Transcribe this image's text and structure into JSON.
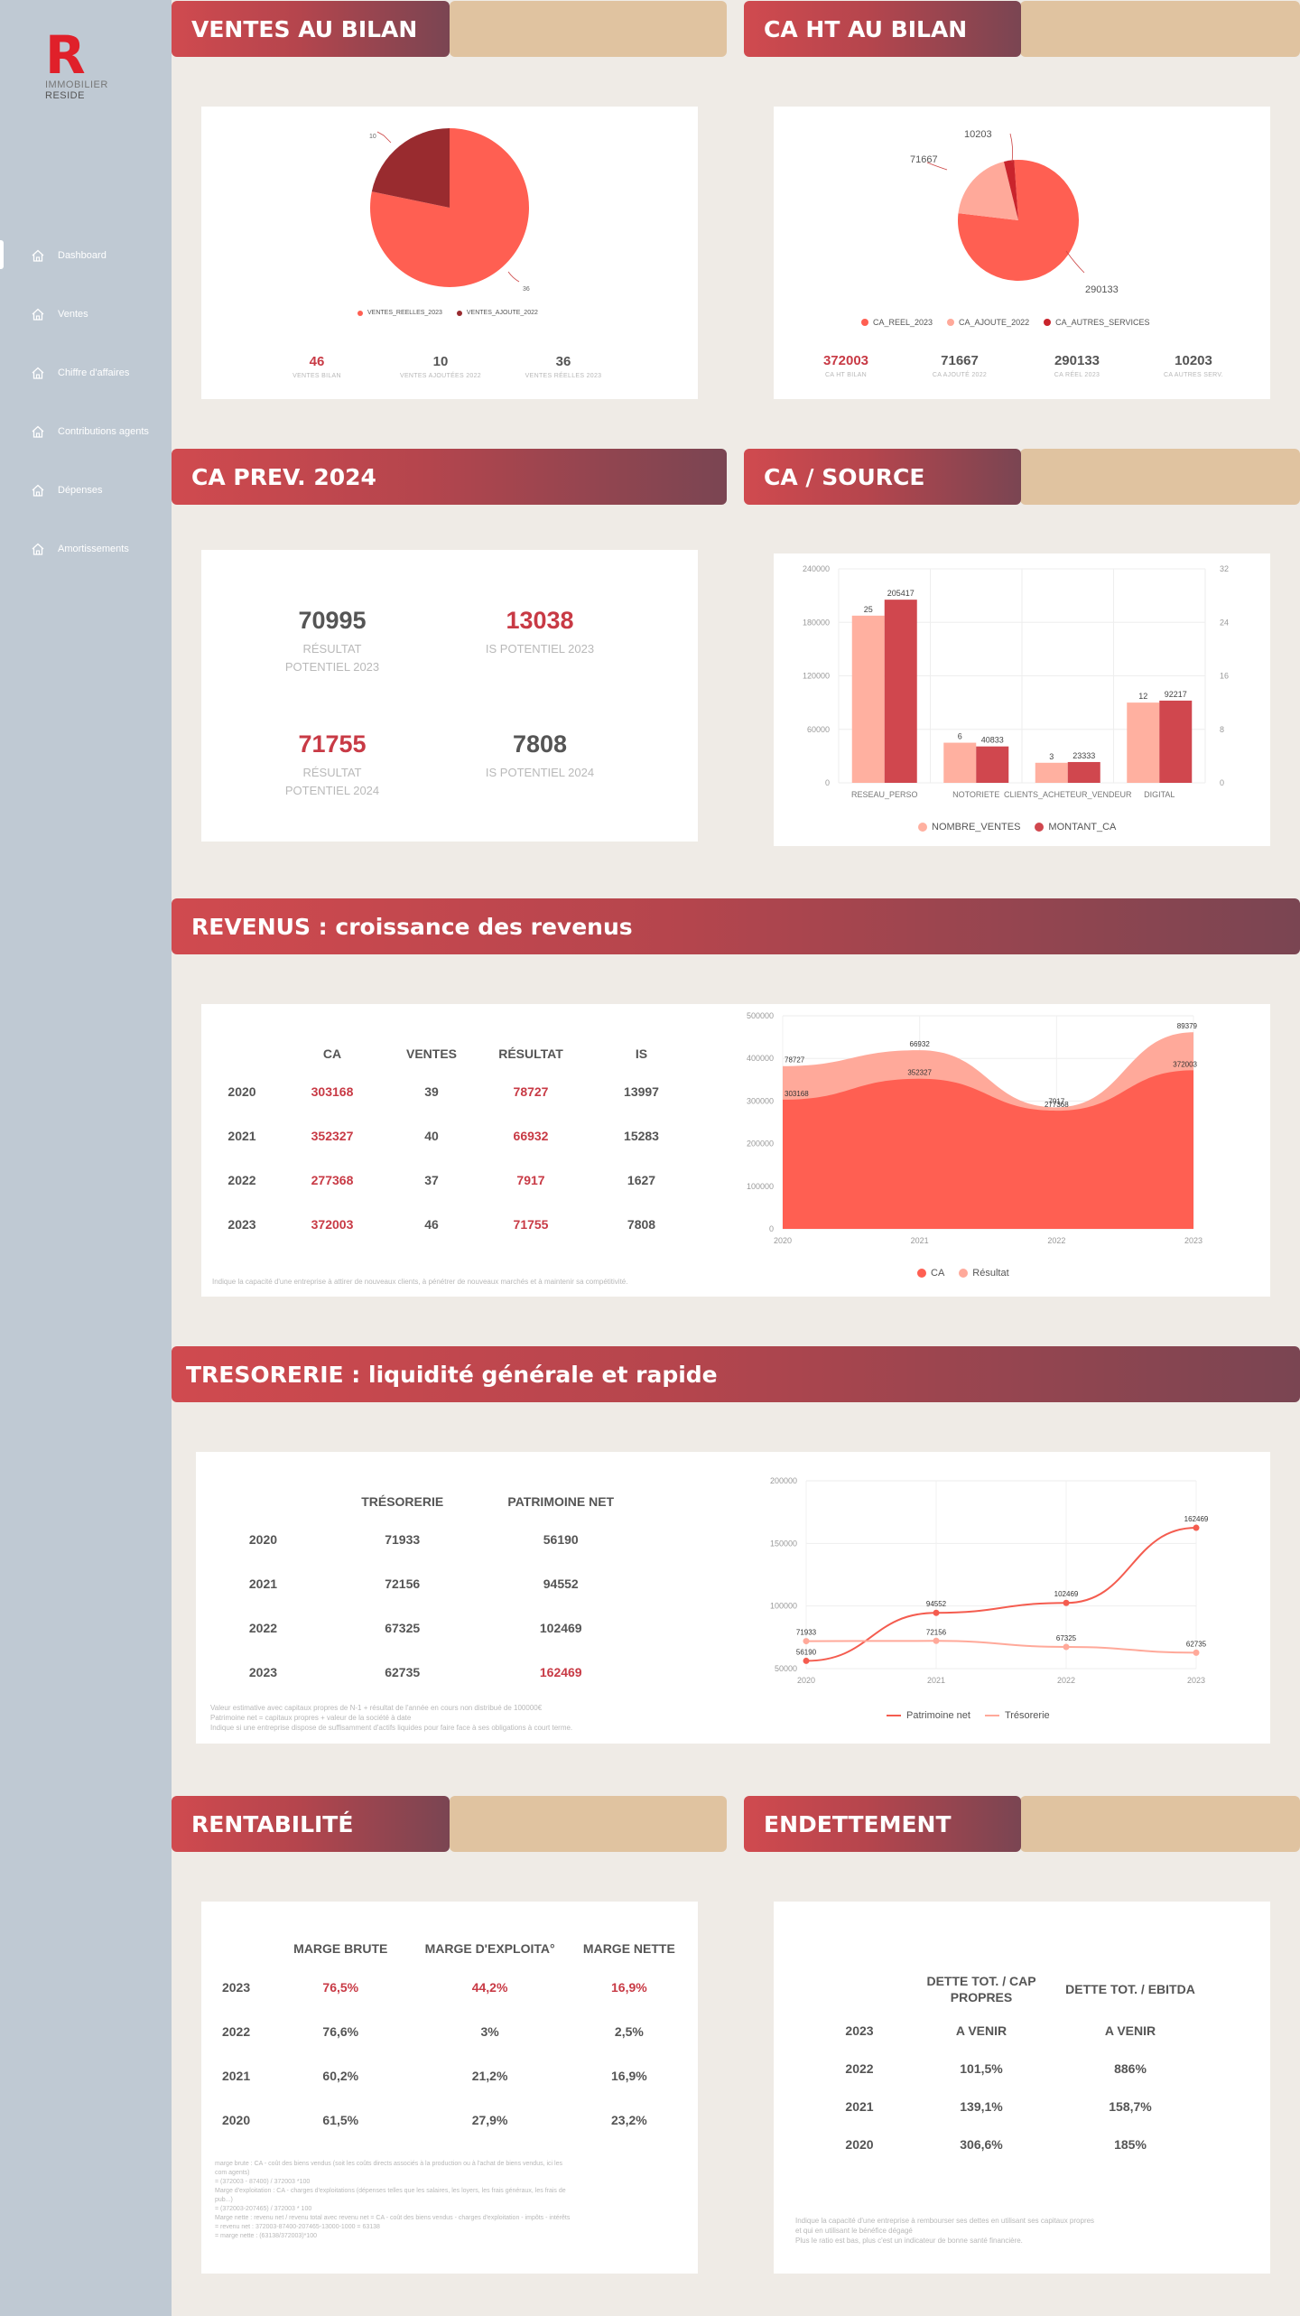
{
  "sidebar": {
    "logo_letter": "R",
    "logo_line1": "IMMOBILIER",
    "logo_line2": "RESIDE",
    "items": [
      {
        "label": "Dashboard"
      },
      {
        "label": "Ventes"
      },
      {
        "label": "Chiffre d'affaires"
      },
      {
        "label": "Contributions agents"
      },
      {
        "label": "Dépenses"
      },
      {
        "label": "Amortissements"
      }
    ]
  },
  "ventes": {
    "title": "VENTES AU BILAN",
    "legend": [
      "VENTES_REELLES_2023",
      "VENTES_AJOUTE_2022"
    ],
    "stats": [
      {
        "value": "46",
        "label": "VENTES BILAN"
      },
      {
        "value": "10",
        "label": "VENTES AJOUTÉES 2022"
      },
      {
        "value": "36",
        "label": "VENTES RÉELLES 2023"
      }
    ],
    "pie_labels": [
      "10",
      "36"
    ]
  },
  "ca_ht": {
    "title": "CA HT AU BILAN",
    "legend": [
      "CA_REEL_2023",
      "CA_AJOUTE_2022",
      "CA_AUTRES_SERVICES"
    ],
    "stats": [
      {
        "value": "372003",
        "label": "CA HT BILAN"
      },
      {
        "value": "71667",
        "label": "CA AJOUTÉ 2022"
      },
      {
        "value": "290133",
        "label": "CA RÉEL 2023"
      },
      {
        "value": "10203",
        "label": "CA AUTRES SERV."
      }
    ],
    "pie_labels": [
      "10203",
      "71667",
      "290133"
    ]
  },
  "ca_prev": {
    "title": "CA PREV. 2024",
    "items": [
      {
        "value": "70995",
        "label1": "RÉSULTAT",
        "label2": "POTENTIEL 2023"
      },
      {
        "value": "13038",
        "label1": "IS POTENTIEL 2023",
        "label2": ""
      },
      {
        "value": "71755",
        "label1": "RÉSULTAT",
        "label2": "POTENTIEL 2024"
      },
      {
        "value": "7808",
        "label1": "IS POTENTIEL 2024",
        "label2": ""
      }
    ]
  },
  "ca_source": {
    "title": "CA / SOURCE",
    "legend": [
      "NOMBRE_VENTES",
      "MONTANT_CA"
    ]
  },
  "revenus": {
    "title": "REVENUS : croissance des revenus",
    "headers": [
      "",
      "CA",
      "VENTES",
      "RÉSULTAT",
      "IS"
    ],
    "rows": [
      [
        "2020",
        "303168",
        "39",
        "78727",
        "13997"
      ],
      [
        "2021",
        "352327",
        "40",
        "66932",
        "15283"
      ],
      [
        "2022",
        "277368",
        "37",
        "7917",
        "1627"
      ],
      [
        "2023",
        "372003",
        "46",
        "71755",
        "7808"
      ]
    ],
    "note": "Indique la capacité d'une entreprise à attirer de nouveaux clients, à pénétrer de nouveaux marchés et à maintenir sa compétitivité.",
    "legend": [
      "CA",
      "Résultat"
    ]
  },
  "tresorerie": {
    "title": "TRESORERIE : liquidité générale et rapide",
    "headers": [
      "",
      "TRÉSORERIE",
      "PATRIMOINE NET"
    ],
    "rows": [
      [
        "2020",
        "71933",
        "56190"
      ],
      [
        "2021",
        "72156",
        "94552"
      ],
      [
        "2022",
        "67325",
        "102469"
      ],
      [
        "2023",
        "62735",
        "162469"
      ]
    ],
    "note_lines": [
      "Valeur estimative avec capitaux propres de N-1 + résultat de l'année en cours non distribué de 100000€",
      "Patrimoine net = capitaux propres + valeur de la société à date",
      "Indique si une entreprise dispose de suffisamment d'actifs liquides pour faire face à ses obligations à court terme."
    ],
    "legend": [
      "Patrimoine net",
      "Trésorerie"
    ]
  },
  "rentabilite": {
    "title": "RENTABILITÉ",
    "headers": [
      "",
      "MARGE BRUTE",
      "MARGE D'EXPLOITA°",
      "MARGE NETTE"
    ],
    "rows": [
      [
        "2023",
        "76,5%",
        "44,2%",
        "16,9%"
      ],
      [
        "2022",
        "76,6%",
        "3%",
        "2,5%"
      ],
      [
        "2021",
        "60,2%",
        "21,2%",
        "16,9%"
      ],
      [
        "2020",
        "61,5%",
        "27,9%",
        "23,2%"
      ]
    ],
    "note_lines": [
      "marge brute : CA - coût des biens vendus (soit les coûts directs associés à la production ou à l'achat de biens vendus, ici les",
      "com agents)",
      "= (372003 - 87400) / 372003 *100",
      "Marge d'exploitation : CA - charges d'exploitations (dépenses telles que les salaires, les loyers, les frais généraux, les frais de",
      "pub...)",
      "= (372003-207465) / 372003 * 100",
      "Marge nette : revenu net / revenu total avec revenu net = CA - coût des biens vendus - charges d'exploitation - impôts - intérêts",
      "= revenu net : 372003-87400-207465-13000-1000 = 63138",
      "= marge nette : (63138/372003)*100"
    ]
  },
  "endettement": {
    "title": "ENDETTEMENT",
    "headers": [
      "",
      "DETTE TOT. / CAP PROPRES",
      "DETTE TOT. / EBITDA"
    ],
    "rows": [
      [
        "2023",
        "A VENIR",
        "A VENIR"
      ],
      [
        "2022",
        "101,5%",
        "886%"
      ],
      [
        "2021",
        "139,1%",
        "158,7%"
      ],
      [
        "2020",
        "306,6%",
        "185%"
      ]
    ],
    "note_lines": [
      "Indique la capacité d'une entreprise à rembourser ses dettes en utilisant ses capitaux propres",
      "et qui en utilisant le bénéfice dégagé",
      "Plus le ratio est bas, plus c'est un indicateur de bonne santé financière."
    ]
  },
  "chart_data": [
    {
      "type": "pie",
      "categories": [
        "VENTES_REELLES_2023",
        "VENTES_AJOUTE_2022"
      ],
      "values": [
        36,
        10
      ],
      "colors": [
        "#ff5f52",
        "#992b2f"
      ]
    },
    {
      "type": "pie",
      "categories": [
        "CA_REEL_2023",
        "CA_AJOUTE_2022",
        "CA_AUTRES_SERVICES"
      ],
      "values": [
        290133,
        71667,
        10203
      ],
      "colors": [
        "#ff5f52",
        "#ffa99a",
        "#c9242c"
      ]
    },
    {
      "type": "bar",
      "categories": [
        "RESEAU_PERSO",
        "NOTORIETE",
        "CLIENTS_ACHETEUR_VENDEUR",
        "DIGITAL"
      ],
      "series": [
        {
          "name": "NOMBRE_VENTES",
          "values": [
            25,
            6,
            3,
            12
          ],
          "axis": "right",
          "color": "#ffb0a0"
        },
        {
          "name": "MONTANT_CA",
          "values": [
            205417,
            40833,
            23333,
            92217
          ],
          "axis": "left",
          "color": "#d0474e"
        }
      ],
      "ylim": [
        0,
        240000
      ],
      "y2lim": [
        0,
        32
      ],
      "yticks": [
        "0",
        "60000",
        "120000",
        "180000",
        "240000"
      ],
      "y2ticks": [
        "0",
        "8",
        "16",
        "24",
        "32"
      ]
    },
    {
      "type": "area",
      "x": [
        "2020",
        "2021",
        "2022",
        "2023"
      ],
      "series": [
        {
          "name": "CA",
          "values": [
            303168,
            352327,
            277368,
            372003
          ],
          "color": "#ff5f52"
        },
        {
          "name": "Résultat",
          "values": [
            78727,
            66932,
            7917,
            89379
          ],
          "color": "#ffa99a"
        }
      ],
      "ylim": [
        0,
        500000
      ],
      "yticks": [
        "0",
        "100000",
        "200000",
        "300000",
        "400000",
        "500000"
      ]
    },
    {
      "type": "line",
      "x": [
        "2020",
        "2021",
        "2022",
        "2023"
      ],
      "series": [
        {
          "name": "Patrimoine net",
          "values": [
            56190,
            94552,
            102469,
            162469
          ],
          "color": "#f45c4f"
        },
        {
          "name": "Trésorerie",
          "values": [
            71933,
            72156,
            67325,
            62735
          ],
          "color": "#ffa99a"
        }
      ],
      "ylim": [
        50000,
        200000
      ],
      "yticks": [
        "50000",
        "100000",
        "150000",
        "200000"
      ]
    }
  ]
}
